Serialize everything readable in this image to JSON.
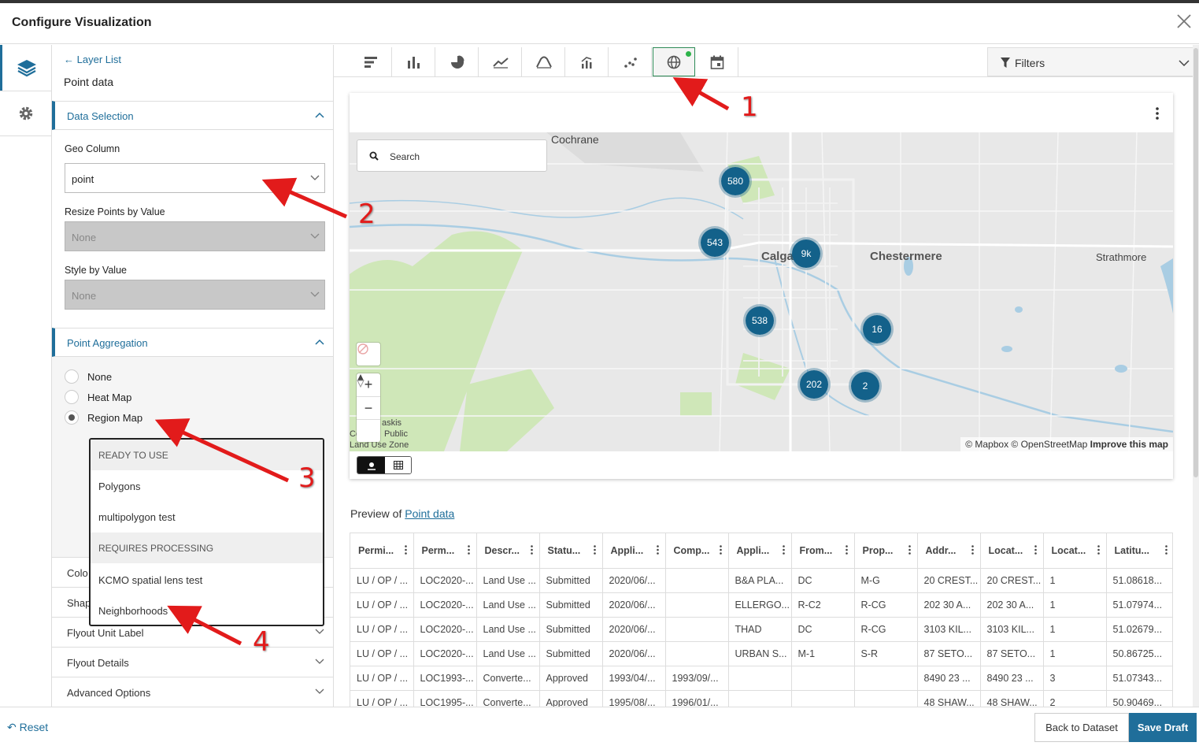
{
  "window": {
    "title": "Configure Visualization"
  },
  "panel": {
    "back_link": "Layer List",
    "subtitle": "Point data",
    "data_selection": {
      "header": "Data Selection",
      "geo_column": {
        "label": "Geo Column",
        "value": "point"
      },
      "resize_points": {
        "label": "Resize Points by Value",
        "value": "None"
      },
      "style_by_value": {
        "label": "Style by Value",
        "value": "None"
      }
    },
    "point_aggregation": {
      "header": "Point Aggregation",
      "options": [
        {
          "label": "None",
          "checked": false
        },
        {
          "label": "Heat Map",
          "checked": false
        },
        {
          "label": "Region Map",
          "checked": true
        }
      ]
    },
    "partial_rows": [
      "Colo",
      "Shap"
    ],
    "collapsed_sections": [
      "Flyout Unit Label",
      "Flyout Details",
      "Advanced Options"
    ]
  },
  "dropdown": {
    "groups": [
      {
        "header": "READY TO USE",
        "items": [
          "Polygons",
          "multipolygon test"
        ]
      },
      {
        "header": "REQUIRES PROCESSING",
        "items": [
          "KCMO spatial lens test",
          "Neighborhoods"
        ]
      }
    ]
  },
  "toolbar": {
    "chart_types": [
      "bar-horizontal-icon",
      "bar-vertical-icon",
      "pie-icon",
      "line-icon",
      "area-icon",
      "histogram-icon",
      "scatter-icon",
      "map-globe-icon",
      "calendar-icon"
    ],
    "active": "map-globe-icon",
    "filters_label": "Filters"
  },
  "map": {
    "search_placeholder": "Search",
    "places": [
      "Cochrane",
      "Calgary",
      "Chestermere",
      "Strathmore",
      "askis",
      "Co",
      "Public",
      "Land Use Zone"
    ],
    "clusters": [
      "580",
      "543",
      "9k",
      "538",
      "16",
      "202",
      "2"
    ],
    "attribution": "© Mapbox © OpenStreetMap",
    "improve_link": "Improve this map",
    "zoom_in": "+",
    "zoom_out": "−"
  },
  "preview": {
    "prefix": "Preview of",
    "dataset_link": "Point data",
    "columns": [
      "Permi...",
      "Perm...",
      "Descr...",
      "Statu...",
      "Appli...",
      "Comp...",
      "Appli...",
      "From...",
      "Prop...",
      "Addr...",
      "Locat...",
      "Locat...",
      "Latitu..."
    ],
    "rows": [
      [
        "LU / OP / ...",
        "LOC2020-...",
        "Land Use ...",
        "Submitted",
        "2020/06/...",
        "",
        "B&A PLA...",
        "DC",
        "M-G",
        "20 CREST...",
        "20 CREST...",
        "1",
        "51.08618..."
      ],
      [
        "LU / OP / ...",
        "LOC2020-...",
        "Land Use ...",
        "Submitted",
        "2020/06/...",
        "",
        "ELLERGO...",
        "R-C2",
        "R-CG",
        "202 30 A...",
        "202 30 A...",
        "1",
        "51.07974..."
      ],
      [
        "LU / OP / ...",
        "LOC2020-...",
        "Land Use ...",
        "Submitted",
        "2020/06/...",
        "",
        "THAD",
        "DC",
        "R-CG",
        "3103 KIL...",
        "3103 KIL...",
        "1",
        "51.02679..."
      ],
      [
        "LU / OP / ...",
        "LOC2020-...",
        "Land Use ...",
        "Submitted",
        "2020/06/...",
        "",
        "URBAN S...",
        "M-1",
        "S-R",
        "87 SETO...",
        "87 SETO...",
        "1",
        "50.86725..."
      ],
      [
        "LU / OP / ...",
        "LOC1993-...",
        "Converte...",
        "Approved",
        "1993/04/...",
        "1993/09/...",
        "",
        "",
        "",
        "8490 23 ...",
        "8490 23 ...",
        "3",
        "51.07343..."
      ],
      [
        "LU / OP / ...",
        "LOC1995-...",
        "Converte...",
        "Approved",
        "1995/08/...",
        "1996/01/...",
        "",
        "",
        "",
        "48 SHAW...",
        "48 SHAW...",
        "2",
        "50.90469..."
      ]
    ]
  },
  "footer": {
    "reset": "Reset",
    "back": "Back to Dataset",
    "save": "Save Draft"
  },
  "annotations": [
    "1",
    "2",
    "3",
    "4"
  ],
  "colors": {
    "accent": "#1f6e9a",
    "cluster": "#13618a",
    "annotation": "#e21b1b",
    "active_dot": "#2db34a"
  }
}
